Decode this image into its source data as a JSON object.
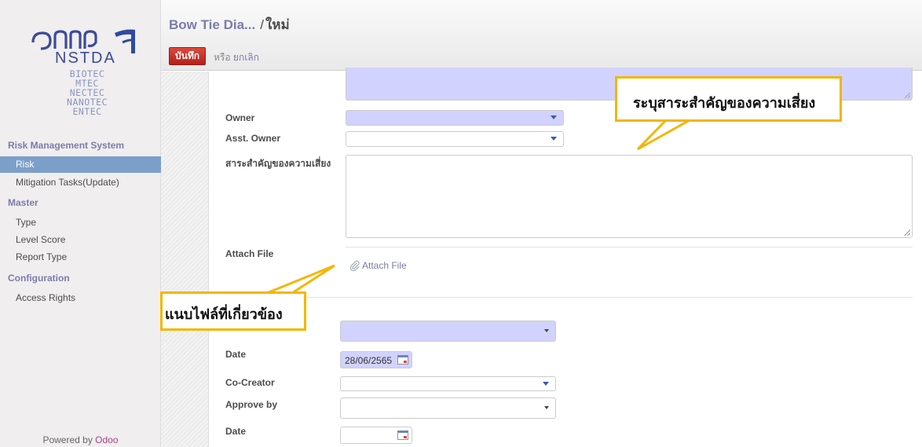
{
  "sidebar": {
    "logo": {
      "main": "สวทช NSTDA",
      "subs": [
        "BIOTEC",
        "MTEC",
        "NECTEC",
        "NANOTEC",
        "ENTEC"
      ]
    },
    "sections": [
      {
        "title": "Risk Management System",
        "items": [
          "Risk",
          "Mitigation Tasks(Update)"
        ]
      },
      {
        "title": "Master",
        "items": [
          "Type",
          "Level Score",
          "Report Type"
        ]
      },
      {
        "title": "Configuration",
        "items": [
          "Access Rights"
        ]
      }
    ],
    "active_item": "Risk",
    "powered_prefix": "Powered by",
    "powered_brand": "Odoo"
  },
  "header": {
    "breadcrumb_parent": "Bow Tie Dia...",
    "breadcrumb_sep": "/",
    "breadcrumb_current": "ใหม่",
    "save_label": "บันทึก",
    "or_label": "หรือ",
    "cancel_label": "ยกเลิก"
  },
  "form": {
    "owner_label": "Owner",
    "asst_owner_label": "Asst. Owner",
    "essence_label": "สาระสำคัญของความเสี่ยง",
    "attach_label": "Attach File",
    "attach_link": "Attach File",
    "date_label": "Date",
    "date_value": "28/06/2565",
    "co_creator_label": "Co-Creator",
    "approve_by_label": "Approve by",
    "date2_label": "Date"
  },
  "callouts": {
    "essence": "ระบุสาระสำคัญของความเสี่ยง",
    "attach": "แนบไฟล์ที่เกี่ยวข้อง"
  },
  "colors": {
    "required_field": "#d2d2ff",
    "callout_border": "#f2b700",
    "sidebar_active": "#7c9fc9",
    "save_button": "#c9302c",
    "accent": "#7c7bad"
  },
  "icons": [
    "paperclip-icon",
    "calendar-icon",
    "dropdown-caret-icon"
  ]
}
